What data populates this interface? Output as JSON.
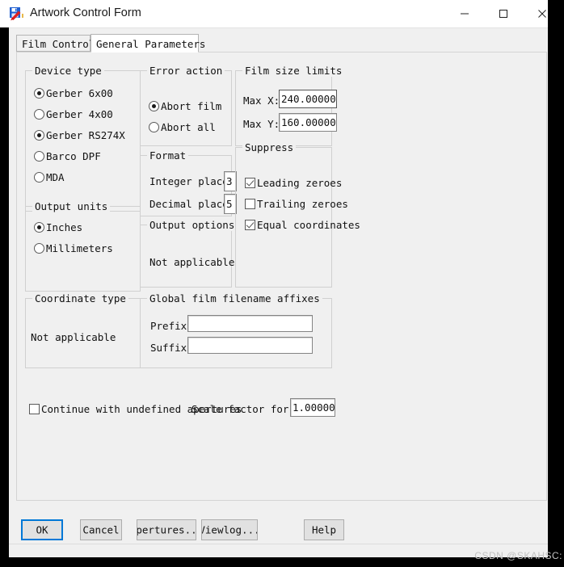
{
  "window": {
    "title": "Artwork Control Form",
    "icon": "artwork-app-icon",
    "controls": {
      "minimize": "minimize-icon",
      "maximize": "maximize-icon",
      "close": "close-icon"
    }
  },
  "tabs": [
    {
      "label": "Film Control",
      "active": false
    },
    {
      "label": "General Parameters",
      "active": true
    }
  ],
  "groups": {
    "device_type": {
      "label": "Device type",
      "options": [
        {
          "label": "Gerber 6x00",
          "selected": false
        },
        {
          "label": "Gerber 4x00",
          "selected": false
        },
        {
          "label": "Gerber RS274X",
          "selected": true
        },
        {
          "label": "Barco DPF",
          "selected": false
        },
        {
          "label": "MDA",
          "selected": false
        }
      ]
    },
    "output_units": {
      "label": "Output units",
      "options": [
        {
          "label": "Inches",
          "selected": true
        },
        {
          "label": "Millimeters",
          "selected": false
        }
      ]
    },
    "coordinate_type": {
      "label": "Coordinate type",
      "text": "Not applicable"
    },
    "error_action": {
      "label": "Error action",
      "options": [
        {
          "label": "Abort film",
          "selected": true
        },
        {
          "label": "Abort all",
          "selected": false
        }
      ]
    },
    "format": {
      "label": "Format",
      "fields": [
        {
          "label": "Integer place",
          "value": "3"
        },
        {
          "label": "Decimal place",
          "value": "5"
        }
      ]
    },
    "output_options": {
      "label": "Output options",
      "text": "Not applicable"
    },
    "film_size_limits": {
      "label": "Film size limits",
      "fields": [
        {
          "label": "Max X:",
          "value": "240.00000"
        },
        {
          "label": "Max Y:",
          "value": "160.00000"
        }
      ]
    },
    "suppress": {
      "label": "Suppress",
      "options": [
        {
          "label": "Leading zeroes",
          "checked": true
        },
        {
          "label": "Trailing zeroes",
          "checked": false
        },
        {
          "label": "Equal coordinates",
          "checked": true
        }
      ]
    },
    "affixes": {
      "label": "Global film filename affixes",
      "fields": [
        {
          "label": "Prefix:",
          "value": ""
        },
        {
          "label": "Suffix:",
          "value": ""
        }
      ]
    }
  },
  "bottom_row": {
    "continue_undefined": {
      "label": "Continue with undefined apertures",
      "checked": false
    },
    "scale_factor": {
      "label": "Scale factor for o",
      "value": "1.00000"
    }
  },
  "buttons": [
    {
      "label": "OK",
      "focused": true
    },
    {
      "label": "Cancel",
      "focused": false
    },
    {
      "label": "Apertures...",
      "focused": false
    },
    {
      "label": "Viewlog...",
      "focused": false
    },
    {
      "label": "Help",
      "focused": false
    }
  ],
  "watermark": "CSDN @SKAHSC:",
  "colors": {
    "window_bg": "#f0f0f0",
    "titlebar_bg": "#ffffff",
    "focus_accent": "#0078d7",
    "field_bg": "#ffffff",
    "group_border": "#d0d0d0"
  }
}
